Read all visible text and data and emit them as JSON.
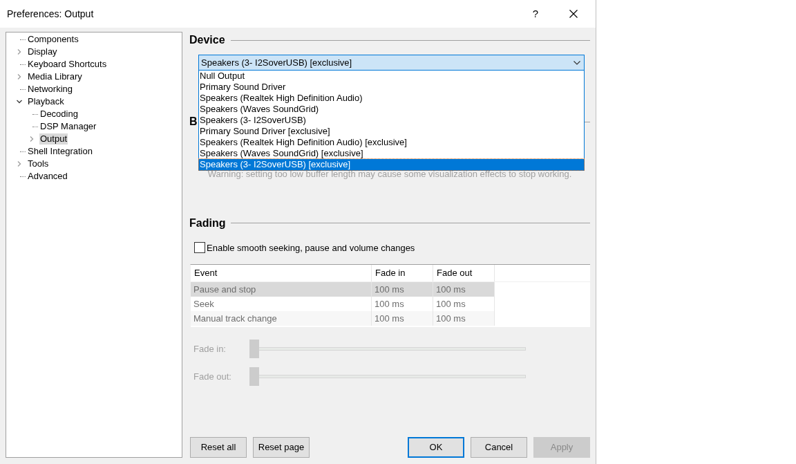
{
  "window": {
    "title": "Preferences: Output",
    "help": "?"
  },
  "tree": [
    {
      "label": "Components",
      "kind": "leaf",
      "selected": false
    },
    {
      "label": "Display",
      "kind": "folder",
      "expanded": false,
      "selected": false
    },
    {
      "label": "Keyboard Shortcuts",
      "kind": "leaf",
      "selected": false
    },
    {
      "label": "Media Library",
      "kind": "folder",
      "expanded": false,
      "selected": false
    },
    {
      "label": "Networking",
      "kind": "leaf",
      "selected": false
    },
    {
      "label": "Playback",
      "kind": "folder",
      "expanded": true,
      "selected": false,
      "children": [
        {
          "label": "Decoding",
          "kind": "leaf",
          "selected": false
        },
        {
          "label": "DSP Manager",
          "kind": "leaf",
          "selected": false
        },
        {
          "label": "Output",
          "kind": "folder",
          "expanded": false,
          "selected": true
        }
      ]
    },
    {
      "label": "Shell Integration",
      "kind": "leaf",
      "selected": false
    },
    {
      "label": "Tools",
      "kind": "folder",
      "expanded": false,
      "selected": false
    },
    {
      "label": "Advanced",
      "kind": "leaf",
      "selected": false
    }
  ],
  "device": {
    "heading": "Device",
    "value": "Speakers (3- I2SoverUSB) [exclusive]",
    "expanded": true,
    "options": [
      {
        "label": "Null Output",
        "selected": false
      },
      {
        "label": "Primary Sound Driver",
        "selected": false
      },
      {
        "label": "Speakers (Realtek High Definition Audio)",
        "selected": false
      },
      {
        "label": "Speakers (Waves SoundGrid)",
        "selected": false
      },
      {
        "label": "Speakers (3- I2SoverUSB)",
        "selected": false
      },
      {
        "label": "Primary Sound Driver [exclusive]",
        "selected": false
      },
      {
        "label": "Speakers (Realtek High Definition Audio) [exclusive]",
        "selected": false
      },
      {
        "label": "Speakers (Waves SoundGrid) [exclusive]",
        "selected": false
      },
      {
        "label": "Speakers (3- I2SoverUSB) [exclusive]",
        "selected": true
      }
    ]
  },
  "buffer": {
    "heading": "B",
    "warning": "Warning: setting too low buffer length may cause some visualization effects to stop working."
  },
  "fading": {
    "heading": "Fading",
    "checkbox": {
      "label": "Enable smooth seeking, pause and volume changes",
      "checked": false
    },
    "table": {
      "columns": [
        "Event",
        "Fade in",
        "Fade out"
      ],
      "rows": [
        {
          "cells": [
            "Pause and stop",
            "100 ms",
            "100 ms"
          ],
          "selected": true
        },
        {
          "cells": [
            "Seek",
            "100 ms",
            "100 ms"
          ],
          "selected": false
        },
        {
          "cells": [
            "Manual track change",
            "100 ms",
            "100 ms"
          ],
          "selected": false
        }
      ]
    },
    "sliders": [
      {
        "label": "Fade in:",
        "level": 0
      },
      {
        "label": "Fade out:",
        "level": 0
      }
    ]
  },
  "buttons": [
    {
      "label": "Reset all",
      "kind": "plain",
      "disabled": false
    },
    {
      "label": "Reset page",
      "kind": "plain",
      "disabled": false
    },
    {
      "label": "OK",
      "kind": "default",
      "disabled": false
    },
    {
      "label": "Cancel",
      "kind": "plain",
      "disabled": false
    },
    {
      "label": "Apply",
      "kind": "plain",
      "disabled": true
    }
  ]
}
